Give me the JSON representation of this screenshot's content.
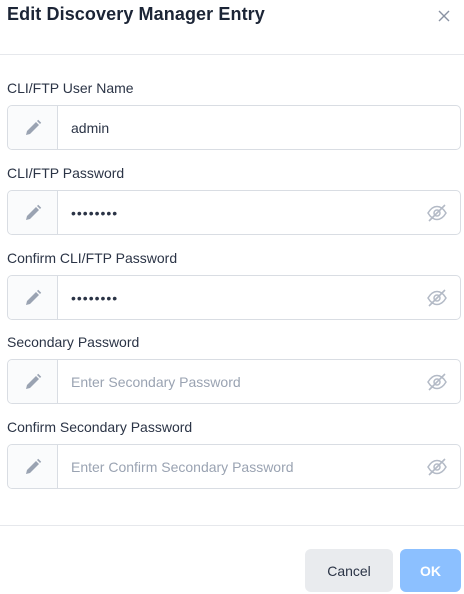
{
  "dialog": {
    "title": "Edit Discovery Manager Entry",
    "close_icon": "close-icon"
  },
  "fields": [
    {
      "label": "CLI/FTP User Name",
      "value": "admin",
      "placeholder": "",
      "type": "text",
      "icon": "pencil-icon"
    },
    {
      "label": "CLI/FTP Password",
      "value": "••••••••",
      "placeholder": "",
      "type": "password",
      "icon": "pencil-icon",
      "toggle_icon": "eye-slash-icon"
    },
    {
      "label": "Confirm CLI/FTP Password",
      "value": "••••••••",
      "placeholder": "",
      "type": "password",
      "icon": "pencil-icon",
      "toggle_icon": "eye-slash-icon"
    },
    {
      "label": "Secondary Password",
      "value": "",
      "placeholder": "Enter Secondary Password",
      "type": "password",
      "icon": "pencil-icon",
      "toggle_icon": "eye-slash-icon"
    },
    {
      "label": "Confirm Secondary Password",
      "value": "",
      "placeholder": "Enter Confirm Secondary Password",
      "type": "password",
      "icon": "pencil-icon",
      "toggle_icon": "eye-slash-icon"
    }
  ],
  "footer": {
    "cancel_label": "Cancel",
    "ok_label": "OK"
  },
  "colors": {
    "primary_disabled": "#8cc0ff",
    "cancel_bg": "#e9ebee",
    "border": "#d9dde3",
    "icon": "#9aa3b2"
  }
}
